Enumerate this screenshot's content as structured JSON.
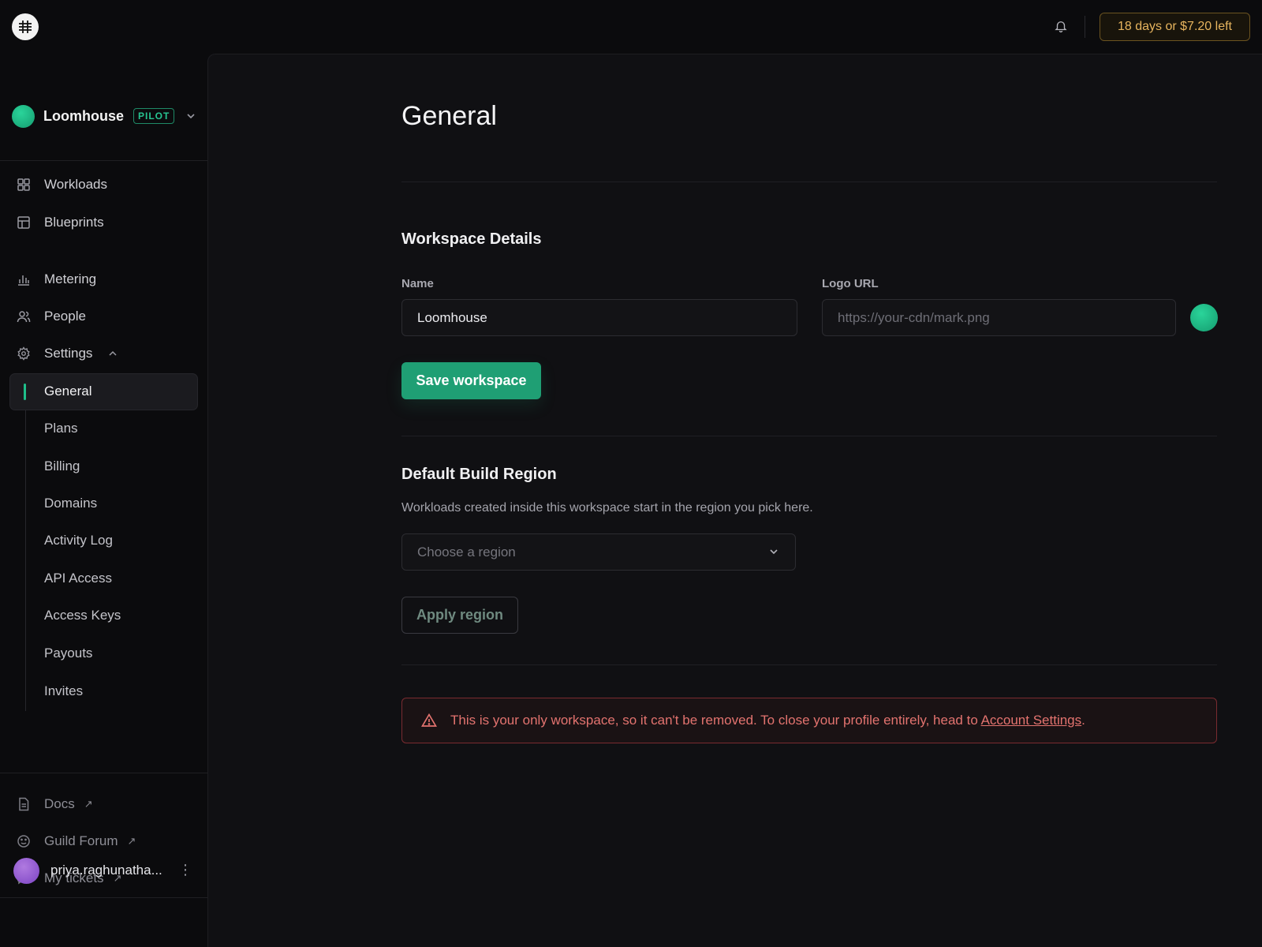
{
  "topbar": {
    "trial_badge": "18 days or $7.20 left",
    "icons": [
      "grid-logo-icon",
      "bell-icon"
    ]
  },
  "workspace": {
    "name": "Loomhouse",
    "badge": "PILOT"
  },
  "sidebar": {
    "nav": [
      {
        "label": "Workloads",
        "icon": "grid-icon"
      },
      {
        "label": "Blueprints",
        "icon": "table-icon"
      },
      {
        "label": "Metering",
        "icon": "bar-chart-icon"
      },
      {
        "label": "People",
        "icon": "users-icon"
      },
      {
        "label": "Settings",
        "icon": "gear-icon",
        "expanded": true
      }
    ],
    "settings_items": [
      {
        "label": "General",
        "active": true
      },
      {
        "label": "Plans"
      },
      {
        "label": "Billing"
      },
      {
        "label": "Domains"
      },
      {
        "label": "Activity Log"
      },
      {
        "label": "API Access"
      },
      {
        "label": "Access Keys"
      },
      {
        "label": "Payouts"
      },
      {
        "label": "Invites"
      }
    ],
    "footer_links": [
      {
        "label": "Docs",
        "icon": "document-icon",
        "ext": "↗"
      },
      {
        "label": "Guild Forum",
        "icon": "smile-icon",
        "ext": "↗"
      },
      {
        "label": "My tickets",
        "icon": "chat-icon",
        "ext": "↗"
      }
    ],
    "user": {
      "name": "priya.raghunatha..."
    }
  },
  "main": {
    "title": "General",
    "details": {
      "title": "Workspace Details",
      "name_label": "Name",
      "name_value": "Loomhouse",
      "logo_label": "Logo URL",
      "logo_placeholder": "https://your-cdn/mark.png",
      "save_label": "Save workspace"
    },
    "region": {
      "title": "Default Build Region",
      "description": "Workloads created inside this workspace start in the region you pick here.",
      "select_placeholder": "Choose a region",
      "apply_label": "Apply region"
    },
    "alert": {
      "text": "This is your only workspace, so it can't be removed. To close your profile entirely, head to ",
      "link": "Account Settings",
      "suffix": "."
    }
  },
  "colors": {
    "accent": "#1f9f74",
    "warning": "#e6b45e",
    "danger": "#e3736f"
  }
}
